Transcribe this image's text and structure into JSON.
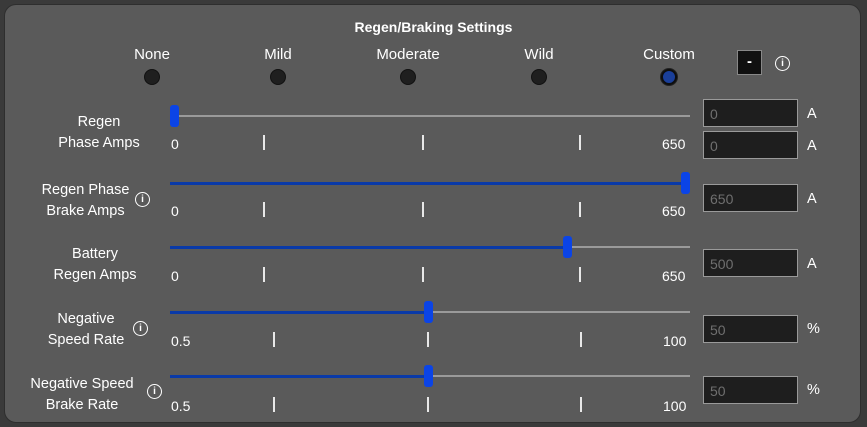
{
  "title": "Regen/Braking Settings",
  "presets": [
    {
      "label": "None",
      "selected": false
    },
    {
      "label": "Mild",
      "selected": false
    },
    {
      "label": "Moderate",
      "selected": false
    },
    {
      "label": "Wild",
      "selected": false
    },
    {
      "label": "Custom",
      "selected": true
    }
  ],
  "minus_button": "-",
  "info_glyph": "i",
  "sliders": [
    {
      "label_line1": "Regen",
      "label_line2": "Phase Amps",
      "has_info": false,
      "min_label": "0",
      "max_label": "650",
      "value_fraction": 0.0,
      "fields": [
        {
          "value": "0",
          "unit": "A"
        },
        {
          "value": "0",
          "unit": "A"
        }
      ]
    },
    {
      "label_line1": "Regen Phase",
      "label_line2": "Brake Amps",
      "has_info": true,
      "min_label": "0",
      "max_label": "650",
      "value_fraction": 1.0,
      "fields": [
        {
          "value": "650",
          "unit": "A"
        }
      ]
    },
    {
      "label_line1": "Battery",
      "label_line2": "Regen Amps",
      "has_info": false,
      "min_label": "0",
      "max_label": "650",
      "value_fraction": 0.769,
      "fields": [
        {
          "value": "500",
          "unit": "A"
        }
      ]
    },
    {
      "label_line1": "Negative",
      "label_line2": "Speed Rate",
      "has_info": true,
      "min_label": "0.5",
      "max_label": "100",
      "value_fraction": 0.497,
      "fields": [
        {
          "value": "50",
          "unit": "%"
        }
      ]
    },
    {
      "label_line1": "Negative Speed",
      "label_line2": "Brake Rate",
      "has_info": true,
      "min_label": "0.5",
      "max_label": "100",
      "value_fraction": 0.497,
      "fields": [
        {
          "value": "50",
          "unit": "%"
        }
      ]
    }
  ]
}
